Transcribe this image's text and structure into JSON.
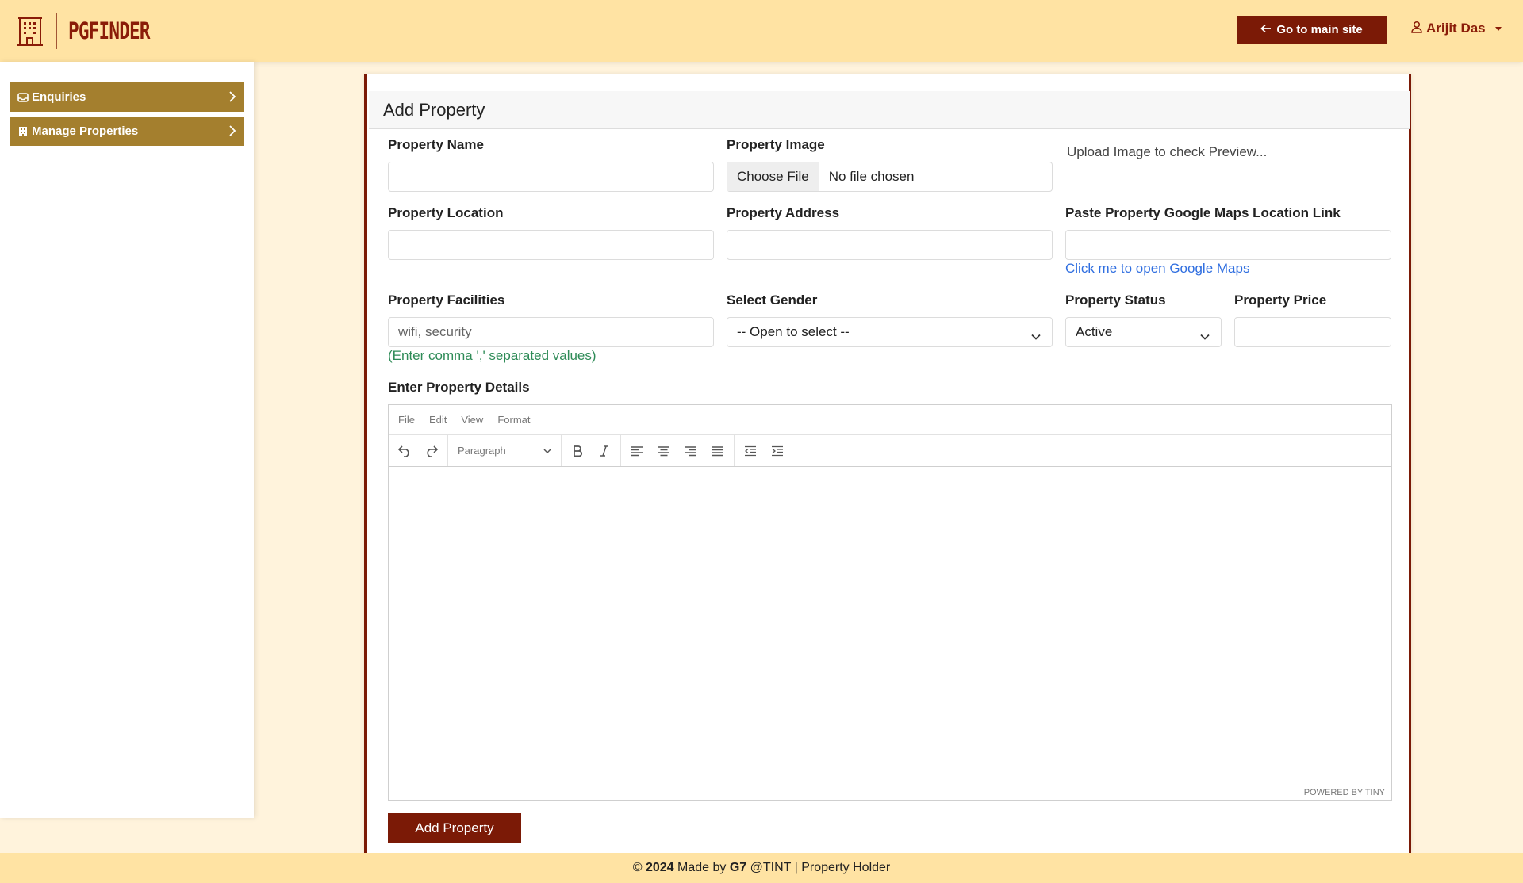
{
  "brand": {
    "name": "PGFINDER",
    "icon": "building-icon"
  },
  "header": {
    "goto_label": "Go to main site",
    "user_name": "Arijit Das"
  },
  "sidebar": {
    "items": [
      {
        "label": "Enquiries",
        "icon": "inbox-icon"
      },
      {
        "label": "Manage Properties",
        "icon": "building-icon"
      }
    ]
  },
  "form": {
    "title": "Add Property",
    "fields": {
      "property_name": {
        "label": "Property Name",
        "value": ""
      },
      "property_image": {
        "label": "Property Image",
        "button": "Choose File",
        "status": "No file chosen"
      },
      "preview_alt": "Upload Image to check Preview...",
      "property_location": {
        "label": "Property Location",
        "value": ""
      },
      "property_address": {
        "label": "Property Address",
        "value": ""
      },
      "maps_link": {
        "label": "Paste Property Google Maps Location Link",
        "value": "",
        "link_text": "Click me to open Google Maps"
      },
      "facilities": {
        "label": "Property Facilities",
        "placeholder": "wifi, security",
        "help": "(Enter comma ',' separated values)"
      },
      "gender": {
        "label": "Select Gender",
        "selected": "-- Open to select --"
      },
      "status": {
        "label": "Property Status",
        "selected": "Active"
      },
      "price": {
        "label": "Property Price",
        "value": ""
      },
      "details": {
        "label": "Enter Property Details"
      }
    },
    "editor": {
      "menu": [
        "File",
        "Edit",
        "View",
        "Format"
      ],
      "block_format": "Paragraph",
      "powered_by": "POWERED BY TINY"
    },
    "submit_label": "Add Property"
  },
  "footer": {
    "copyright": "©",
    "year": "2024",
    "made_by": "Made by",
    "team": "G7",
    "org": "@TINT | Property Holder"
  },
  "colors": {
    "topbar": "#ffe3a3",
    "brand": "#7b1a06",
    "sidebar_item": "#a47f2e",
    "background": "#fff3dc",
    "link": "#2f6ee0",
    "help": "#2e8b57"
  }
}
